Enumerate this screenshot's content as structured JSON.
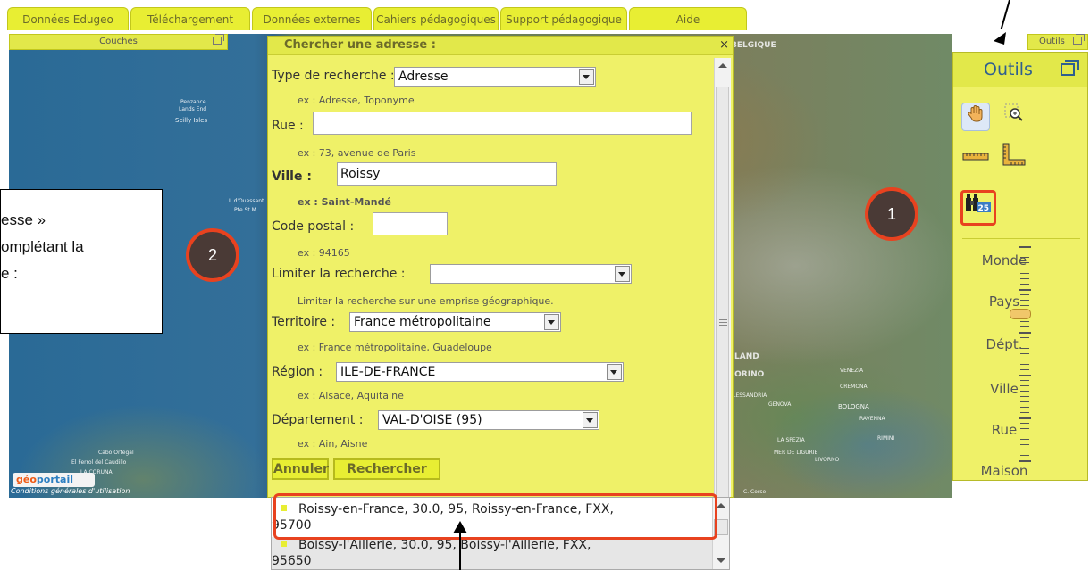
{
  "tabs": [
    "Données Edugeo",
    "Téléchargement",
    "Données externes",
    "Cahiers pédagogiques",
    "Support pédagogique",
    "Aide"
  ],
  "layers_panel": {
    "title": "Couches"
  },
  "tools_bar": {
    "title": "Outils"
  },
  "map_labels": {
    "scilly": "Scilly Isles",
    "penzance": "Penzance",
    "lands_end": "Lands End",
    "ouessant": "I. d'Ouessant",
    "brest": "Pte St M",
    "cabo_ortegal": "Cabo Ortegal",
    "el_ferrol": "El Ferrol del Caudillo",
    "coruna": "LA CORUÑA",
    "belgique": "BELGIQUE",
    "torino": "TORINO",
    "la_spezia": "LA SPEZIA",
    "genova": "GENOVA",
    "livorno": "LIVORNO",
    "bologna": "BOLOGNA",
    "ravenna": "RAVENNA",
    "venezia": "VENEZIA",
    "alessandria": "ALESSANDRIA",
    "cremona": "CREMONA",
    "caprala": "C. Corse",
    "mer": "MER DE LIGURIE",
    "rimini": "RIMINI",
    "land": "LAND"
  },
  "logo": {
    "geo": "géo",
    "portail": "portail",
    "conditions": "Conditions générales d'utilisation"
  },
  "annotation": {
    "line1": "esse »",
    "line2": "omplétant la",
    "line3": "e :"
  },
  "markers": {
    "one": "1",
    "two": "2"
  },
  "dialog": {
    "title": "Chercher une adresse :",
    "close": "×",
    "type_label": "Type de recherche :",
    "type_value": "Adresse",
    "type_hint": "ex : Adresse, Toponyme",
    "rue_label": "Rue :",
    "rue_value": "",
    "rue_hint": "ex : 73, avenue de Paris",
    "ville_label": "Ville :",
    "ville_value": "Roissy",
    "ville_hint": "ex : Saint-Mandé",
    "cp_label": "Code postal :",
    "cp_value": "",
    "cp_hint": "ex : 94165",
    "limit_label": "Limiter la recherche :",
    "limit_value": "",
    "limit_hint": "Limiter la recherche sur une emprise géographique.",
    "territoire_label": "Territoire :",
    "territoire_value": "France métropolitaine",
    "territoire_hint": "ex : France métropolitaine, Guadeloupe",
    "region_label": "Région :",
    "region_value": "ILE-DE-FRANCE",
    "region_hint": "ex : Alsace, Aquitaine",
    "dept_label": "Département :",
    "dept_value": "VAL-D'OISE (95)",
    "dept_hint": "ex : Ain, Aisne",
    "cancel": "Annuler",
    "search": "Rechercher"
  },
  "results": [
    {
      "line1": "Roissy-en-France, 30.0, 95, Roissy-en-France, FXX,",
      "line2": "95700"
    },
    {
      "line1": "Boissy-l'Aillerie, 30.0, 95, Boissy-l'Aillerie, FXX,",
      "line2": "95650"
    }
  ],
  "tools": {
    "title": "Outils",
    "zoom_levels": [
      "Monde",
      "Pays",
      "Dépt.",
      "Ville",
      "Rue",
      "Maison"
    ],
    "badge": "25"
  }
}
